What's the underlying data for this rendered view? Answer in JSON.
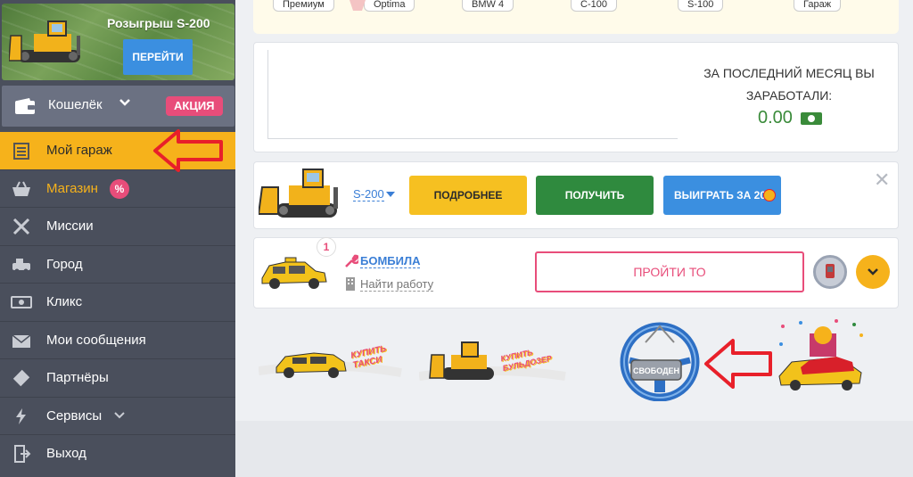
{
  "sidebar": {
    "promo": {
      "title": "Розыгрыш S-200",
      "button": "ПЕРЕЙТИ"
    },
    "wallet": {
      "label": "Кошелёк",
      "badge": "АКЦИЯ"
    },
    "menu": [
      {
        "label": "Мой гараж",
        "icon": "garage-icon"
      },
      {
        "label": "Магазин",
        "icon": "shop-basket-icon",
        "badge": "%"
      },
      {
        "label": "Миссии",
        "icon": "crossed-swords-icon"
      },
      {
        "label": "Город",
        "icon": "city-car-icon"
      },
      {
        "label": "Кликс",
        "icon": "cash-icon"
      },
      {
        "label": "Мои сообщения",
        "icon": "envelope-icon"
      },
      {
        "label": "Партнёры",
        "icon": "handshake-icon"
      },
      {
        "label": "Сервисы",
        "icon": "lightning-icon"
      },
      {
        "label": "Выход",
        "icon": "exit-icon"
      }
    ]
  },
  "topstrip": {
    "pills": [
      "Премиум",
      "Optima",
      "BMW 4",
      "C-100",
      "S-100",
      "Гараж"
    ]
  },
  "earnings": {
    "title": "ЗА ПОСЛЕДНИЙ МЕСЯЦ ВЫ ЗАРАБОТАЛИ:",
    "value": "0.00"
  },
  "tractor_row": {
    "model": "S-200",
    "btn_details": "ПОДРОБНЕЕ",
    "btn_get": "ПОЛУЧИТЬ",
    "btn_win": "ВЫИГРАТЬ ЗА 20",
    "close": "✕"
  },
  "taxi_row": {
    "count": "1",
    "job": "БОМБИЛА",
    "find_work": "Найти работу",
    "btn_to": "ПРОЙТИ ТО"
  },
  "banners": {
    "buy_taxi": "КУПИТЬ ТАКСИ",
    "buy_bulldozer": "КУПИТЬ БУЛЬДОЗЕР",
    "free": "СВОБОДЕН"
  },
  "colors": {
    "sidebar": "#4a4f5c",
    "accent_yellow": "#f6b21b",
    "pink": "#e84d7a",
    "blue": "#3b8fe0",
    "green": "#2f8a3e",
    "red_arrow": "#e8202a"
  }
}
